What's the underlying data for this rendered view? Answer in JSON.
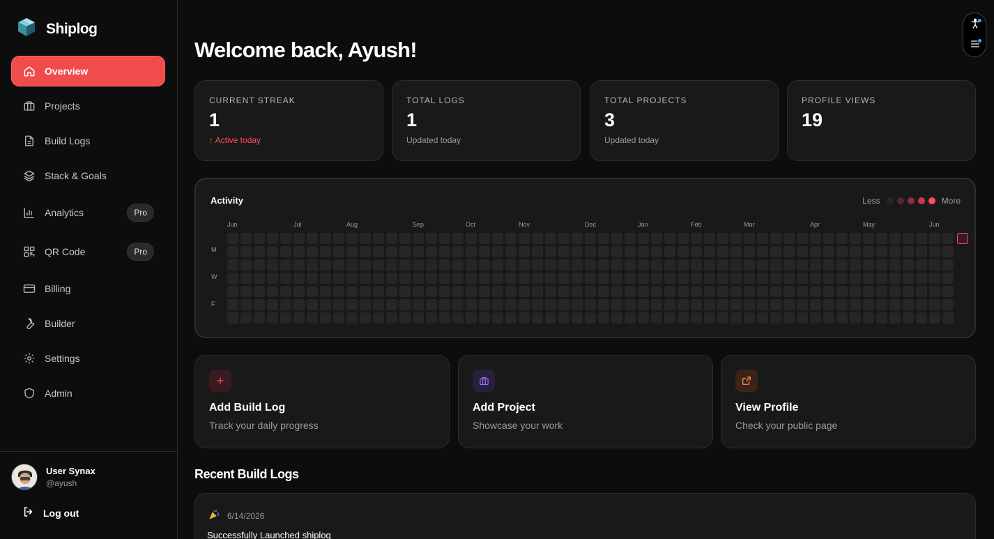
{
  "brand": {
    "name": "Shiplog",
    "logo_icon": "cube-logo-icon"
  },
  "sidebar": {
    "items": [
      {
        "label": "Overview",
        "icon": "home-icon",
        "active": true
      },
      {
        "label": "Projects",
        "icon": "briefcase-icon"
      },
      {
        "label": "Build Logs",
        "icon": "file-text-icon"
      },
      {
        "label": "Stack & Goals",
        "icon": "layers-icon"
      },
      {
        "label": "Analytics",
        "icon": "bar-chart-icon",
        "badge": "Pro"
      },
      {
        "label": "QR Code",
        "icon": "qr-code-icon",
        "badge": "Pro"
      },
      {
        "label": "Billing",
        "icon": "credit-card-icon"
      },
      {
        "label": "Builder",
        "icon": "wrench-icon"
      },
      {
        "label": "Settings",
        "icon": "gear-icon"
      },
      {
        "label": "Admin",
        "icon": "shield-icon"
      }
    ]
  },
  "user": {
    "name": "User Synax",
    "handle": "@ayush",
    "logout_label": "Log out"
  },
  "header": {
    "title": "Welcome back, Ayush!"
  },
  "stats": [
    {
      "label": "Current Streak",
      "value": "1",
      "sub": "↑ Active today",
      "highlight": true
    },
    {
      "label": "Total Logs",
      "value": "1",
      "sub": "Updated today"
    },
    {
      "label": "Total Projects",
      "value": "3",
      "sub": "Updated today"
    },
    {
      "label": "Profile Views",
      "value": "19",
      "sub": ""
    }
  ],
  "activity": {
    "title": "Activity",
    "legend_less": "Less",
    "legend_more": "More",
    "legend_colors": [
      "#262626",
      "#5a2430",
      "#8c2c3c",
      "#c53a4e",
      "#ff4d5e"
    ],
    "months": [
      "Jun",
      "Jul",
      "Aug",
      "Sep",
      "Oct",
      "Nov",
      "Dec",
      "Jan",
      "Feb",
      "Mar",
      "Apr",
      "May",
      "Jun"
    ],
    "day_labels": [
      "M",
      "W",
      "F"
    ]
  },
  "actions": [
    {
      "title": "Add Build Log",
      "sub": "Track your daily progress",
      "icon": "plus-icon",
      "color": "#ff4d5e",
      "bg": "#3a1a1f"
    },
    {
      "title": "Add Project",
      "sub": "Showcase your work",
      "icon": "briefcase-icon",
      "color": "#9b6bff",
      "bg": "#26203a"
    },
    {
      "title": "View Profile",
      "sub": "Check your public page",
      "icon": "external-link-icon",
      "color": "#ff8a3d",
      "bg": "#3a2418"
    }
  ],
  "recent": {
    "title": "Recent Build Logs",
    "logs": [
      {
        "date": "6/14/2026",
        "text": "Successfully Launched shiplog",
        "icon": "party-popper-icon"
      }
    ]
  }
}
